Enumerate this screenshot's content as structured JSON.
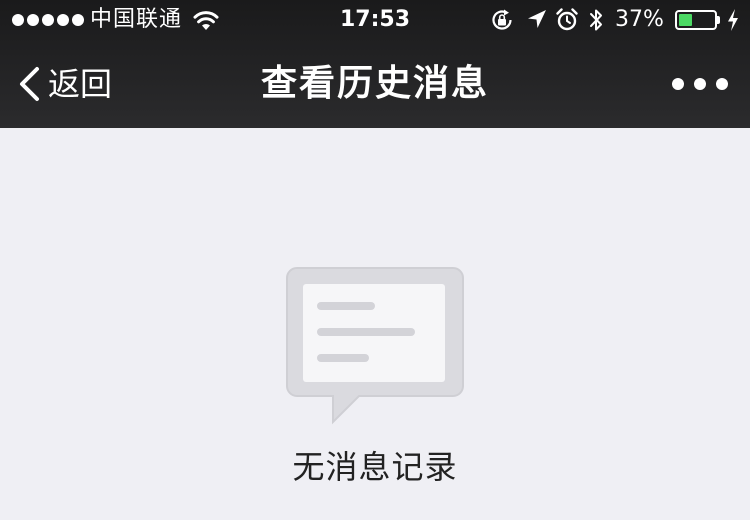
{
  "status_bar": {
    "signal_dots": 5,
    "carrier": "中国联通",
    "time": "17:53",
    "battery_percent": "37%",
    "battery_level": 0.37,
    "icons": [
      "wifi-icon",
      "rotation-lock-icon",
      "location-icon",
      "alarm-icon",
      "bluetooth-icon",
      "charging-icon"
    ]
  },
  "nav_bar": {
    "back_label": "返回",
    "title": "查看历史消息",
    "more_icon": "more-dots-icon"
  },
  "empty_state": {
    "icon": "empty-message-icon",
    "message": "无消息记录"
  },
  "colors": {
    "topbar_bg": "#1f1f20",
    "page_bg": "#efeff4",
    "battery_fill": "#4cd964",
    "text": "#222222"
  }
}
